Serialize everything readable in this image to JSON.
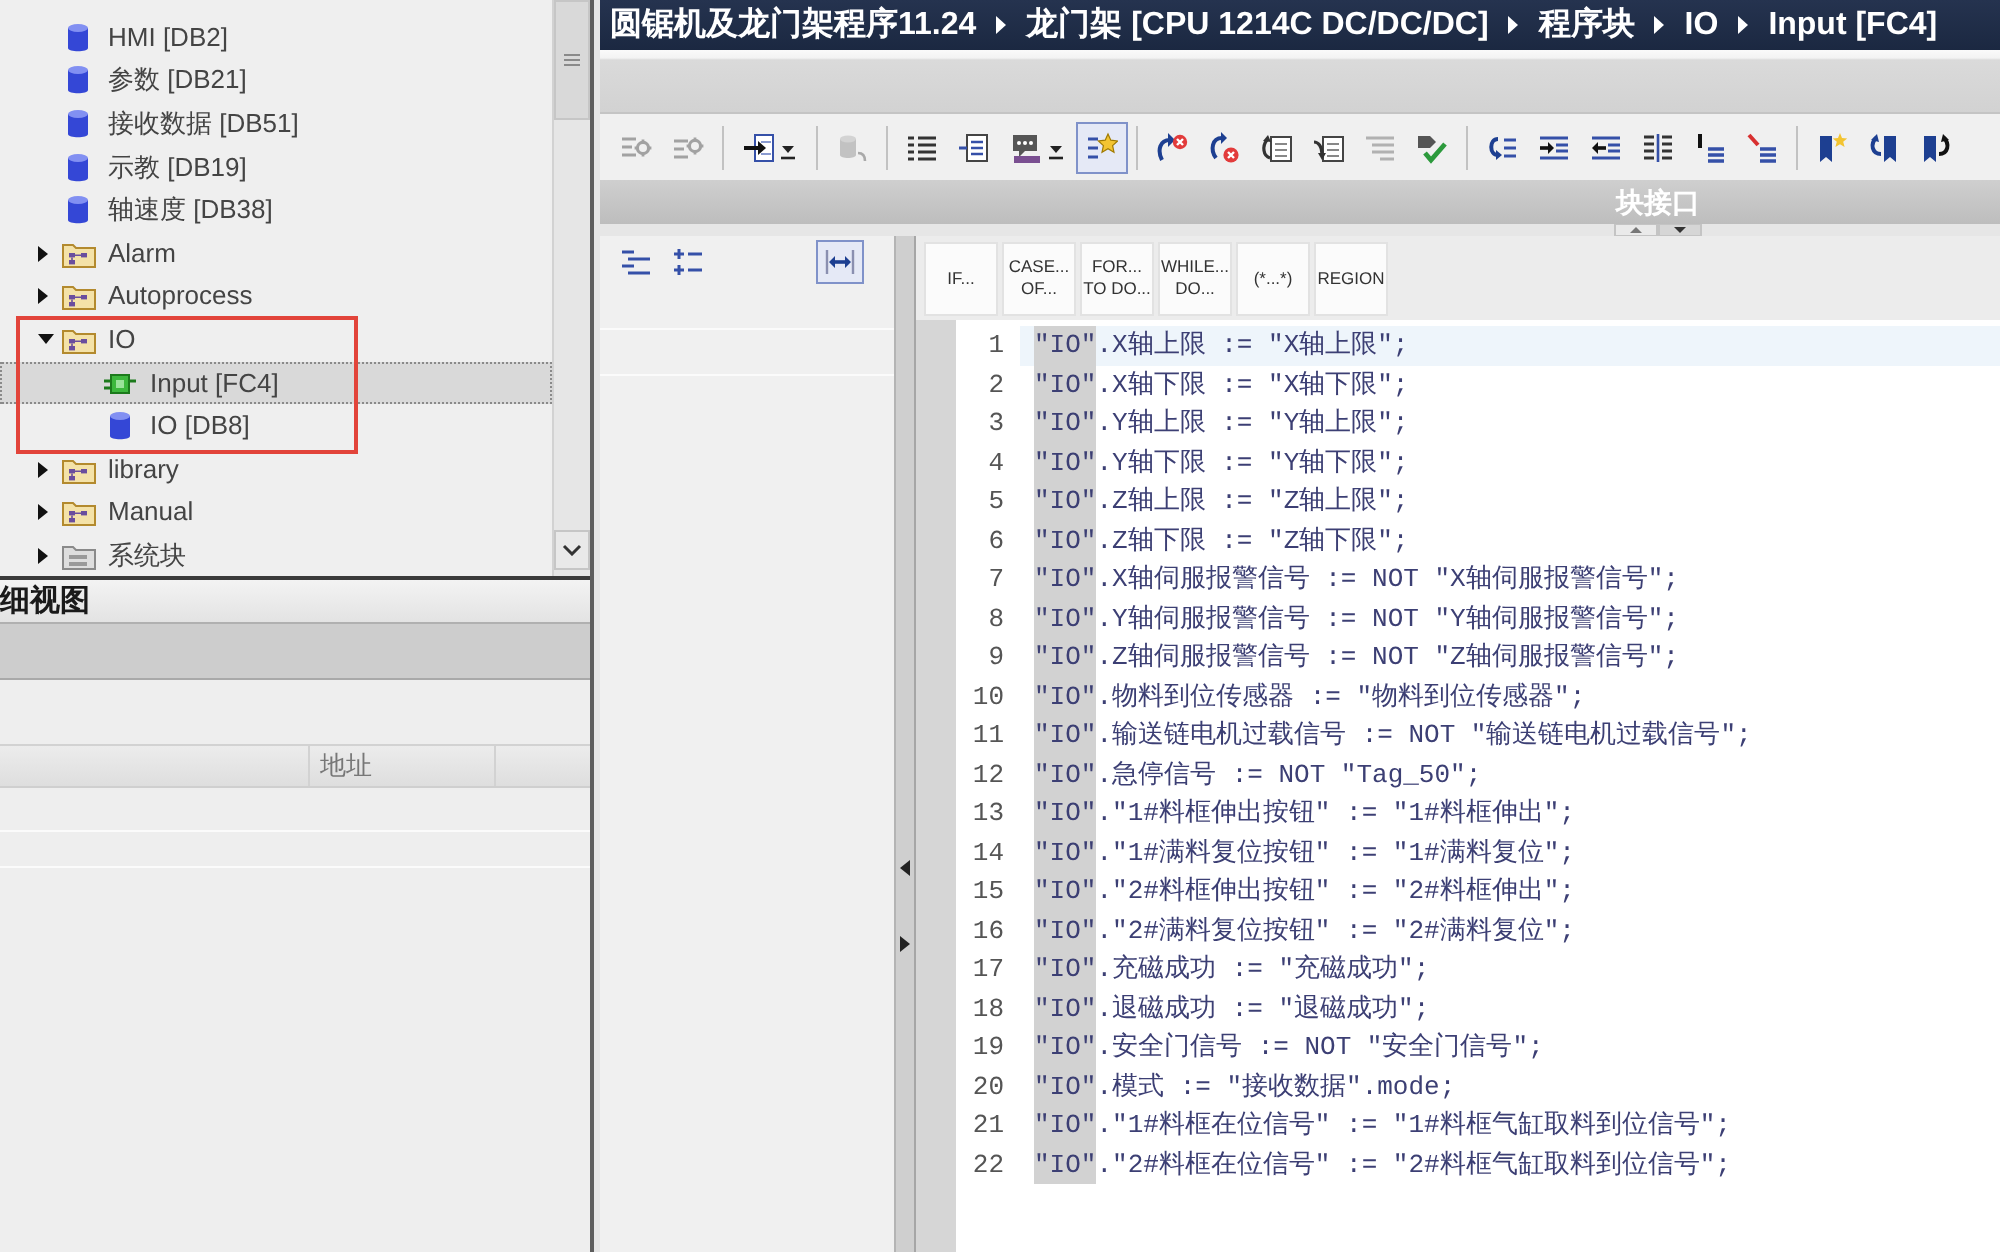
{
  "project_tree": {
    "items": [
      {
        "kind": "data_block",
        "label": "HMI [DB2]",
        "selected": false,
        "framed": false
      },
      {
        "kind": "data_block",
        "label": "参数 [DB21]",
        "selected": false,
        "framed": false
      },
      {
        "kind": "data_block",
        "label": "接收数据 [DB51]",
        "selected": false,
        "framed": false
      },
      {
        "kind": "data_block",
        "label": "示教 [DB19]",
        "selected": false,
        "framed": false
      },
      {
        "kind": "data_block",
        "label": "轴速度 [DB38]",
        "selected": false,
        "framed": false
      },
      {
        "kind": "folder",
        "label": "Alarm",
        "expanded": false,
        "selected": false,
        "framed": false
      },
      {
        "kind": "folder",
        "label": "Autoprocess",
        "expanded": false,
        "selected": false,
        "framed": false
      },
      {
        "kind": "folder",
        "label": "IO",
        "expanded": true,
        "selected": false,
        "framed": true,
        "children": [
          {
            "kind": "function",
            "label": "Input [FC4]",
            "selected": true
          },
          {
            "kind": "data_block",
            "label": "IO [DB8]",
            "selected": false
          }
        ]
      },
      {
        "kind": "folder",
        "label": "library",
        "expanded": false,
        "selected": false,
        "framed": false
      },
      {
        "kind": "folder",
        "label": "Manual",
        "expanded": false,
        "selected": false,
        "framed": false
      },
      {
        "kind": "system_folder",
        "label": "系统块",
        "expanded": false,
        "selected": false,
        "framed": false
      }
    ]
  },
  "detail_view": {
    "title": "细视图",
    "columns": [
      "地址"
    ]
  },
  "editor": {
    "breadcrumb": [
      "圆锯机及龙门架程序11.24",
      "龙门架 [CPU 1214C DC/DC/DC]",
      "程序块",
      "IO",
      "Input [FC4]"
    ],
    "toolbar": [
      {
        "disabled": true,
        "pressed": false
      },
      {
        "disabled": true,
        "pressed": false
      },
      {
        "disabled": false,
        "pressed": false
      },
      {
        "disabled": true,
        "pressed": false
      },
      {
        "disabled": false,
        "pressed": false
      },
      {
        "disabled": false,
        "pressed": false
      },
      {
        "disabled": false,
        "pressed": false
      },
      {
        "disabled": false,
        "pressed": true
      },
      {
        "disabled": false,
        "pressed": false
      },
      {
        "disabled": false,
        "pressed": false
      },
      {
        "disabled": false,
        "pressed": false
      },
      {
        "disabled": false,
        "pressed": false
      },
      {
        "disabled": true,
        "pressed": false
      },
      {
        "disabled": false,
        "pressed": false
      },
      {
        "disabled": false,
        "pressed": false
      },
      {
        "disabled": false,
        "pressed": false
      },
      {
        "disabled": false,
        "pressed": false
      },
      {
        "disabled": false,
        "pressed": false
      },
      {
        "disabled": false,
        "pressed": false
      },
      {
        "disabled": false,
        "pressed": false
      },
      {
        "disabled": false,
        "pressed": false
      },
      {
        "disabled": false,
        "pressed": false
      },
      {
        "disabled": false,
        "pressed": false
      }
    ],
    "interface_panel": {
      "title": "块接口"
    },
    "pane_toolbar": [
      {
        "pressed": false
      },
      {
        "pressed": false
      },
      {
        "pressed": true
      }
    ],
    "instructions": [
      "IF...",
      "CASE...\nOF...",
      "FOR...\nTO DO...",
      "WHILE...\nDO...",
      "(*...*)",
      "REGION"
    ],
    "code_lines": [
      {
        "number": "1",
        "highlighted": "\"IO\"",
        "text": ".X轴上限 := \"X轴上限\";",
        "current": true
      },
      {
        "number": "2",
        "highlighted": "\"IO\"",
        "text": ".X轴下限 := \"X轴下限\";",
        "current": false
      },
      {
        "number": "3",
        "highlighted": "\"IO\"",
        "text": ".Y轴上限 := \"Y轴上限\";",
        "current": false
      },
      {
        "number": "4",
        "highlighted": "\"IO\"",
        "text": ".Y轴下限 := \"Y轴下限\";",
        "current": false
      },
      {
        "number": "5",
        "highlighted": "\"IO\"",
        "text": ".Z轴上限 := \"Z轴上限\";",
        "current": false
      },
      {
        "number": "6",
        "highlighted": "\"IO\"",
        "text": ".Z轴下限 := \"Z轴下限\";",
        "current": false
      },
      {
        "number": "7",
        "highlighted": "\"IO\"",
        "text": ".X轴伺服报警信号 := NOT \"X轴伺服报警信号\";",
        "current": false
      },
      {
        "number": "8",
        "highlighted": "\"IO\"",
        "text": ".Y轴伺服报警信号 := NOT \"Y轴伺服报警信号\";",
        "current": false
      },
      {
        "number": "9",
        "highlighted": "\"IO\"",
        "text": ".Z轴伺服报警信号 := NOT \"Z轴伺服报警信号\";",
        "current": false
      },
      {
        "number": "10",
        "highlighted": "\"IO\"",
        "text": ".物料到位传感器 := \"物料到位传感器\";",
        "current": false
      },
      {
        "number": "11",
        "highlighted": "\"IO\"",
        "text": ".输送链电机过载信号 := NOT \"输送链电机过载信号\";",
        "current": false
      },
      {
        "number": "12",
        "highlighted": "\"IO\"",
        "text": ".急停信号 := NOT \"Tag_50\";",
        "current": false
      },
      {
        "number": "13",
        "highlighted": "\"IO\"",
        "text": ".\"1#料框伸出按钮\" := \"1#料框伸出\";",
        "current": false
      },
      {
        "number": "14",
        "highlighted": "\"IO\"",
        "text": ".\"1#满料复位按钮\" := \"1#满料复位\";",
        "current": false
      },
      {
        "number": "15",
        "highlighted": "\"IO\"",
        "text": ".\"2#料框伸出按钮\" := \"2#料框伸出\";",
        "current": false
      },
      {
        "number": "16",
        "highlighted": "\"IO\"",
        "text": ".\"2#满料复位按钮\" := \"2#满料复位\";",
        "current": false
      },
      {
        "number": "17",
        "highlighted": "\"IO\"",
        "text": ".充磁成功 := \"充磁成功\";",
        "current": false
      },
      {
        "number": "18",
        "highlighted": "\"IO\"",
        "text": ".退磁成功 := \"退磁成功\";",
        "current": false
      },
      {
        "number": "19",
        "highlighted": "\"IO\"",
        "text": ".安全门信号 := NOT \"安全门信号\";",
        "current": false
      },
      {
        "number": "20",
        "highlighted": "\"IO\"",
        "text": ".模式 := \"接收数据\".mode;",
        "current": false
      },
      {
        "number": "21",
        "highlighted": "\"IO\"",
        "text": ".\"1#料框在位信号\" := \"1#料框气缸取料到位信号\";",
        "current": false
      },
      {
        "number": "22",
        "highlighted": "\"IO\"",
        "text": ".\"2#料框在位信号\" := \"2#料框气缸取料到位信号\";",
        "current": false
      }
    ]
  }
}
